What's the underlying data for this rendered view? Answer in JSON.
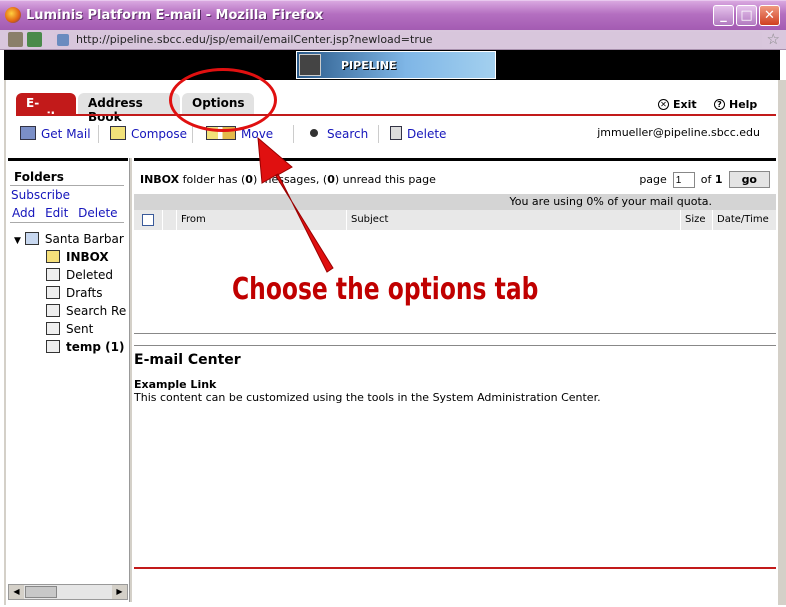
{
  "window": {
    "title": "Luminis Platform E-mail - Mozilla Firefox",
    "min": "_",
    "max": "□",
    "close": "✕"
  },
  "addressbar": {
    "url": "http://pipeline.sbcc.edu/jsp/email/emailCenter.jsp?newload=true",
    "star": "☆"
  },
  "banner": {
    "logo_text": "PIPELINE"
  },
  "tabs": [
    {
      "label": "E-mail"
    },
    {
      "label": "Address Book"
    },
    {
      "label": "Options"
    }
  ],
  "header_links": {
    "exit": "Exit",
    "help": "Help"
  },
  "toolbar": {
    "get_mail": "Get Mail",
    "compose": "Compose",
    "move": "Move",
    "search": "Search",
    "delete": "Delete",
    "user_email": "jmmueller@pipeline.sbcc.edu"
  },
  "sidebar": {
    "folders_heading": "Folders",
    "subscribe": "Subscribe",
    "add": "Add",
    "edit": "Edit",
    "delete": "Delete",
    "root": "Santa Barbar",
    "items": [
      {
        "label": "INBOX",
        "bold": true
      },
      {
        "label": "Deleted",
        "bold": false
      },
      {
        "label": "Drafts",
        "bold": false
      },
      {
        "label": "Search Re",
        "bold": false
      },
      {
        "label": "Sent",
        "bold": false
      },
      {
        "label": "temp (1)",
        "bold": true
      }
    ]
  },
  "mailbox": {
    "folder": "INBOX",
    "text_a": " folder has (",
    "messages": "0",
    "text_b": ") messages, (",
    "unread": "0",
    "text_c": ") unread this page",
    "page_label": "page",
    "page_value": "1",
    "of_label": "of",
    "total_pages": "1",
    "go": "go",
    "quota": "You are using 0% of your mail quota.",
    "columns": {
      "from": "From",
      "subject": "Subject",
      "size": "Size",
      "datetime": "Date/Time"
    }
  },
  "email_center": {
    "title": "E-mail Center",
    "link": "Example Link",
    "content": "This content can be customized using the tools in the System Administration Center."
  },
  "annotation": {
    "text": "Choose the options tab",
    "color": "#c00000"
  }
}
